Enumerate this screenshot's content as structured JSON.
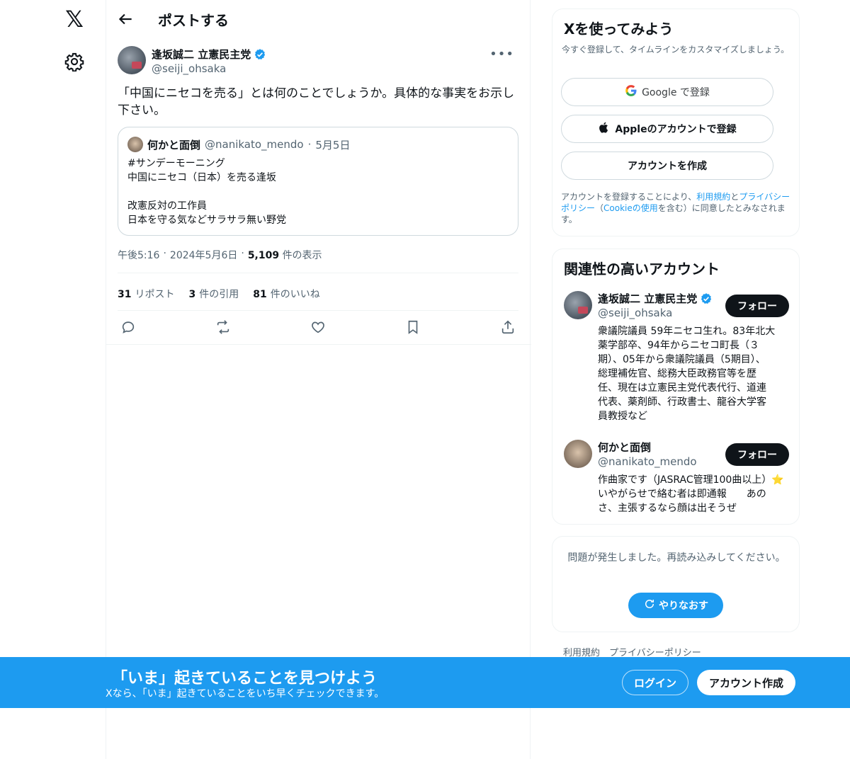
{
  "nav": {
    "logo": "𝕏"
  },
  "header": {
    "title": "ポストする"
  },
  "tweet": {
    "author_name": "逢坂誠二 立憲民主党",
    "handle": "@seiji_ohsaka",
    "text_line1": "「中国にニセコを売る」とは何のことでしょうか。具体的な事実をお示し",
    "text_line2": "下さい。",
    "quote": {
      "author_name": "何かと面倒",
      "handle": "@nanikato_mendo",
      "dot": "·",
      "date": "5月5日",
      "lines": [
        "#サンデーモーニング",
        "中国にニセコ（日本）を売る逢坂",
        "",
        "改憲反対の工作員",
        "日本を守る気などサラサラ無い野党"
      ]
    },
    "time": "午後5:16",
    "sep1": "·",
    "date": "2024年5月6日",
    "sep2": "·",
    "views_count": "5,109",
    "views_label": "件の表示",
    "reposts_count": "31",
    "reposts_label": "リポスト",
    "quotes_count": "3",
    "quotes_label": "件の引用",
    "likes_count": "81",
    "likes_label": "件のいいね"
  },
  "signup": {
    "title": "Xを使ってみよう",
    "subtitle": "今すぐ登録して、タイムラインをカスタマイズしましょう。",
    "google_label": "Google で登録",
    "apple_label": "Appleのアカウントで登録",
    "create_label": "アカウントを作成",
    "terms_prefix": "アカウントを登録することにより、",
    "terms_link": "利用規約",
    "terms_and": "と",
    "privacy_link": "プライバシーポリシー",
    "paren_open": "（",
    "cookie_link": "Cookieの使用",
    "terms_suffix": "を含む）に同意したとみなされます。"
  },
  "related": {
    "title": "関連性の高いアカウント",
    "accounts": [
      {
        "name": "逢坂誠二 立憲民主党",
        "handle": "@seiji_ohsaka",
        "follow": "フォロー",
        "bio": [
          "衆議院議員 59年ニセコ生れ。83年北大",
          "薬学部卒、94年からニセコ町長（３",
          "期）、05年から衆議院議員（5期目）、",
          "総理補佐官、総務大臣政務官等を歴",
          "任、現在は立憲民主党代表代行、道連",
          "代表、薬剤師、行政書士、龍谷大学客",
          "員教授など"
        ]
      },
      {
        "name": "何かと面倒",
        "handle": "@nanikato_mendo",
        "follow": "フォロー",
        "bio": [
          "作曲家です（JASRAC管理100曲以上）⭐",
          "いやがらせで絡む者は即通報　　あの",
          "さ、主張するなら顔は出そうぜ"
        ]
      }
    ]
  },
  "error": {
    "message": "問題が発生しました。再読み込みしてください。",
    "retry": "やりなおす"
  },
  "footer": {
    "terms": "利用規約",
    "privacy": "プライバシーポリシー"
  },
  "banner": {
    "title": "「いま」起きていることを見つけよう",
    "subtitle": "Xなら、「いま」起きていることをいち早くチェックできます。",
    "login": "ログイン",
    "signup": "アカウント作成"
  },
  "colors": {
    "accent": "#1d9bf0",
    "text": "#0f1419",
    "secondary": "#536471",
    "border": "#eff3f4"
  }
}
